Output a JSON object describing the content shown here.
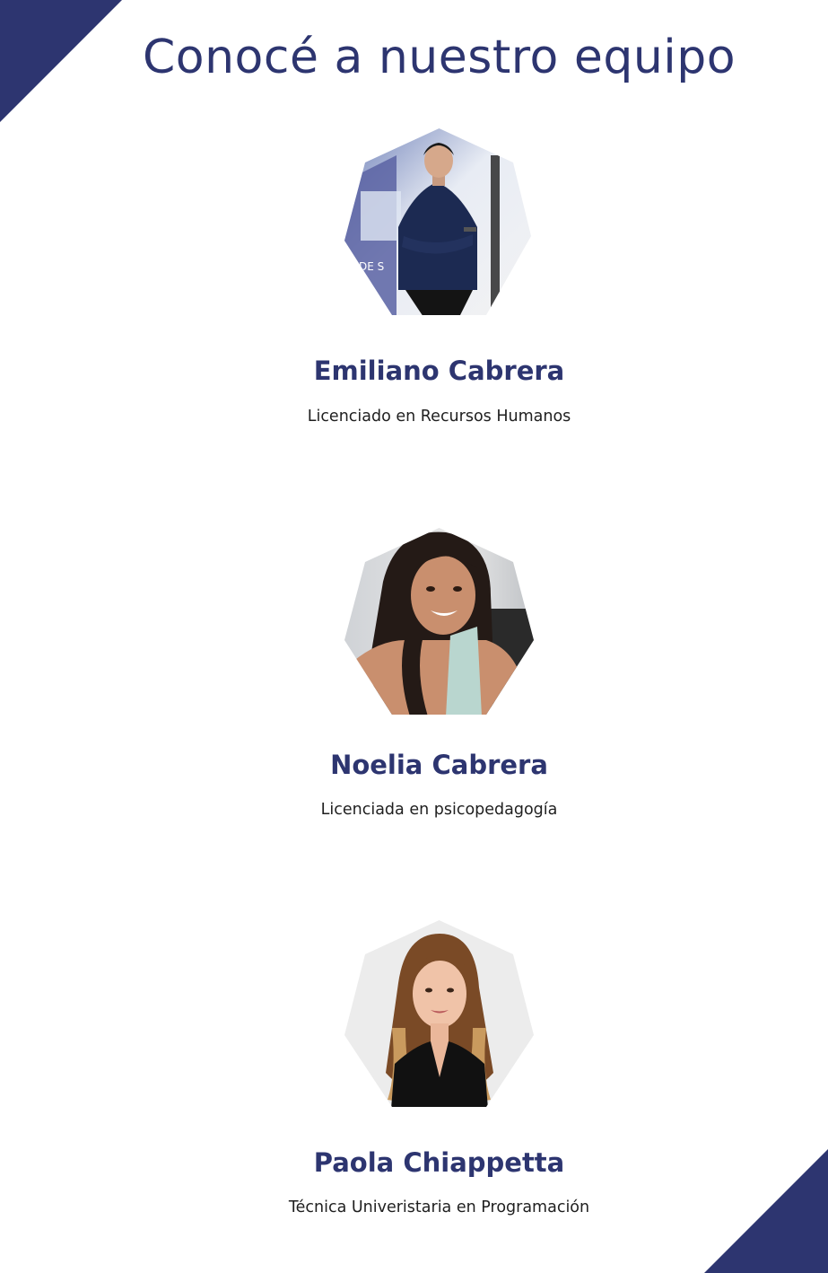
{
  "page": {
    "title": "Conocé a nuestro equipo",
    "accent_color": "#2d3570"
  },
  "team": [
    {
      "name": "Emiliano Cabrera",
      "role": "Licenciado en Recursos Humanos",
      "photo_icon": "person-photo",
      "photo_sign_text": "DE S"
    },
    {
      "name": "Noelia Cabrera",
      "role": "Licenciada en psicopedagogía",
      "photo_icon": "person-photo"
    },
    {
      "name": "Paola Chiappetta",
      "role": "Técnica Univeristaria en Programación",
      "photo_icon": "person-photo"
    }
  ]
}
